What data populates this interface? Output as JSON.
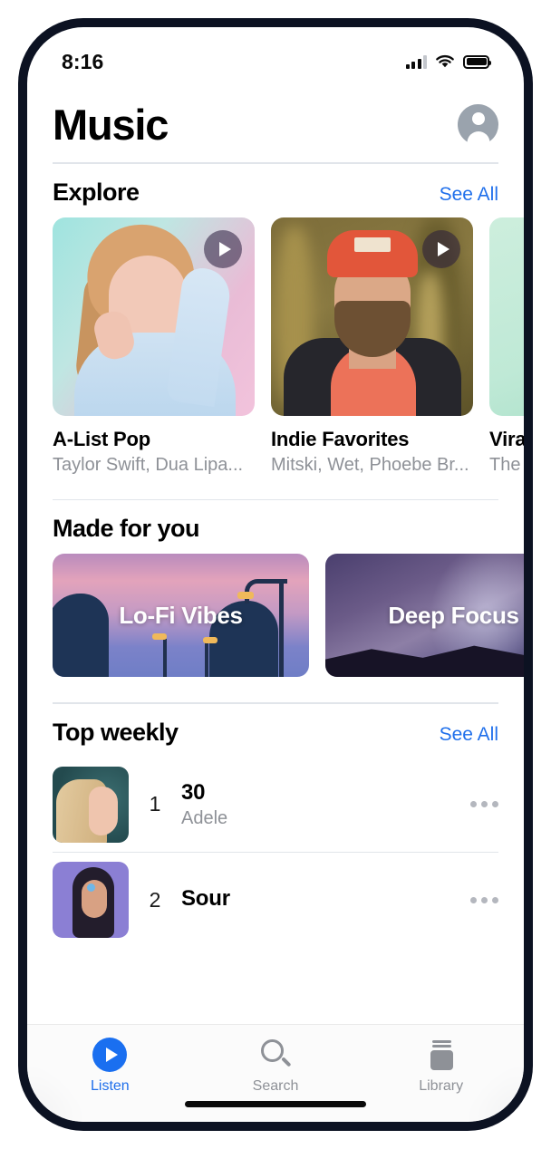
{
  "status_bar": {
    "time": "8:16",
    "cellular_icon": "cellular-bars-icon",
    "wifi_icon": "wifi-icon",
    "battery_icon": "battery-full-icon"
  },
  "header": {
    "title": "Music",
    "avatar_icon": "account-avatar-icon"
  },
  "accent_colors": {
    "link_blue": "#1f6feb",
    "active_tab_blue": "#1a6ff0",
    "divider_gray": "#e1e5ea",
    "secondary_text": "#8e9197"
  },
  "sections": {
    "explore": {
      "title": "Explore",
      "see_all_label": "See All",
      "cards": [
        {
          "title": "A-List Pop",
          "subtitle": "Taylor Swift, Dua Lipa...",
          "play_icon": "play-icon"
        },
        {
          "title": "Indie Favorites",
          "subtitle": "Mitski, Wet, Phoebe Br...",
          "play_icon": "play-icon"
        },
        {
          "title": "Viral Hits",
          "subtitle": "The Weeknd...",
          "play_icon": "play-icon"
        }
      ]
    },
    "made_for_you": {
      "title": "Made for you",
      "cards": [
        {
          "label": "Lo-Fi Vibes"
        },
        {
          "label": "Deep Focus"
        }
      ]
    },
    "top_weekly": {
      "title": "Top weekly",
      "see_all_label": "See All",
      "tracks": [
        {
          "rank": "1",
          "name": "30",
          "artist": "Adele",
          "more_icon": "more-horizontal-icon"
        },
        {
          "rank": "2",
          "name": "Sour",
          "artist": "",
          "more_icon": "more-horizontal-icon"
        }
      ]
    }
  },
  "tab_bar": {
    "tabs": [
      {
        "label": "Listen",
        "icon": "play-circle-icon",
        "active": true
      },
      {
        "label": "Search",
        "icon": "search-icon",
        "active": false
      },
      {
        "label": "Library",
        "icon": "library-books-icon",
        "active": false
      }
    ]
  }
}
